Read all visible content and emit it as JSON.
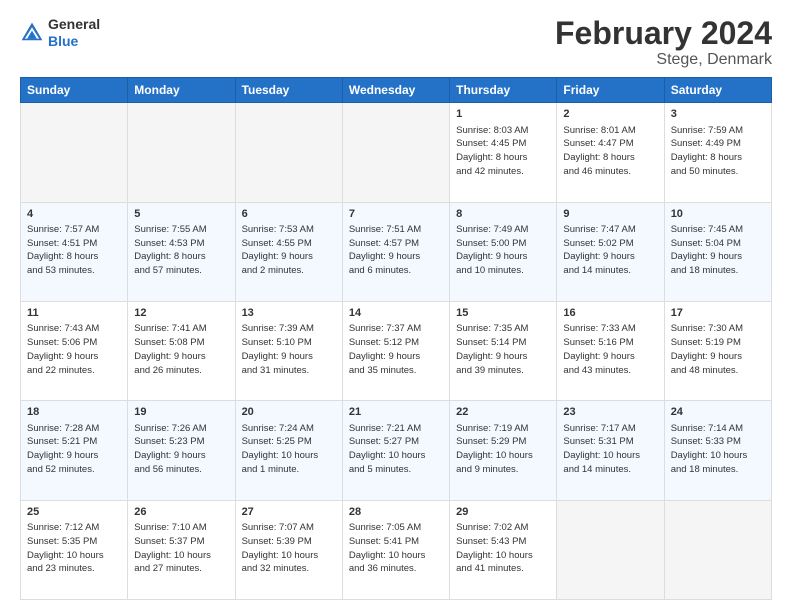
{
  "header": {
    "logo_line1": "General",
    "logo_line2": "Blue",
    "title": "February 2024",
    "subtitle": "Stege, Denmark"
  },
  "days": [
    "Sunday",
    "Monday",
    "Tuesday",
    "Wednesday",
    "Thursday",
    "Friday",
    "Saturday"
  ],
  "weeks": [
    [
      {
        "num": "",
        "info": ""
      },
      {
        "num": "",
        "info": ""
      },
      {
        "num": "",
        "info": ""
      },
      {
        "num": "",
        "info": ""
      },
      {
        "num": "1",
        "info": "Sunrise: 8:03 AM\nSunset: 4:45 PM\nDaylight: 8 hours\nand 42 minutes."
      },
      {
        "num": "2",
        "info": "Sunrise: 8:01 AM\nSunset: 4:47 PM\nDaylight: 8 hours\nand 46 minutes."
      },
      {
        "num": "3",
        "info": "Sunrise: 7:59 AM\nSunset: 4:49 PM\nDaylight: 8 hours\nand 50 minutes."
      }
    ],
    [
      {
        "num": "4",
        "info": "Sunrise: 7:57 AM\nSunset: 4:51 PM\nDaylight: 8 hours\nand 53 minutes."
      },
      {
        "num": "5",
        "info": "Sunrise: 7:55 AM\nSunset: 4:53 PM\nDaylight: 8 hours\nand 57 minutes."
      },
      {
        "num": "6",
        "info": "Sunrise: 7:53 AM\nSunset: 4:55 PM\nDaylight: 9 hours\nand 2 minutes."
      },
      {
        "num": "7",
        "info": "Sunrise: 7:51 AM\nSunset: 4:57 PM\nDaylight: 9 hours\nand 6 minutes."
      },
      {
        "num": "8",
        "info": "Sunrise: 7:49 AM\nSunset: 5:00 PM\nDaylight: 9 hours\nand 10 minutes."
      },
      {
        "num": "9",
        "info": "Sunrise: 7:47 AM\nSunset: 5:02 PM\nDaylight: 9 hours\nand 14 minutes."
      },
      {
        "num": "10",
        "info": "Sunrise: 7:45 AM\nSunset: 5:04 PM\nDaylight: 9 hours\nand 18 minutes."
      }
    ],
    [
      {
        "num": "11",
        "info": "Sunrise: 7:43 AM\nSunset: 5:06 PM\nDaylight: 9 hours\nand 22 minutes."
      },
      {
        "num": "12",
        "info": "Sunrise: 7:41 AM\nSunset: 5:08 PM\nDaylight: 9 hours\nand 26 minutes."
      },
      {
        "num": "13",
        "info": "Sunrise: 7:39 AM\nSunset: 5:10 PM\nDaylight: 9 hours\nand 31 minutes."
      },
      {
        "num": "14",
        "info": "Sunrise: 7:37 AM\nSunset: 5:12 PM\nDaylight: 9 hours\nand 35 minutes."
      },
      {
        "num": "15",
        "info": "Sunrise: 7:35 AM\nSunset: 5:14 PM\nDaylight: 9 hours\nand 39 minutes."
      },
      {
        "num": "16",
        "info": "Sunrise: 7:33 AM\nSunset: 5:16 PM\nDaylight: 9 hours\nand 43 minutes."
      },
      {
        "num": "17",
        "info": "Sunrise: 7:30 AM\nSunset: 5:19 PM\nDaylight: 9 hours\nand 48 minutes."
      }
    ],
    [
      {
        "num": "18",
        "info": "Sunrise: 7:28 AM\nSunset: 5:21 PM\nDaylight: 9 hours\nand 52 minutes."
      },
      {
        "num": "19",
        "info": "Sunrise: 7:26 AM\nSunset: 5:23 PM\nDaylight: 9 hours\nand 56 minutes."
      },
      {
        "num": "20",
        "info": "Sunrise: 7:24 AM\nSunset: 5:25 PM\nDaylight: 10 hours\nand 1 minute."
      },
      {
        "num": "21",
        "info": "Sunrise: 7:21 AM\nSunset: 5:27 PM\nDaylight: 10 hours\nand 5 minutes."
      },
      {
        "num": "22",
        "info": "Sunrise: 7:19 AM\nSunset: 5:29 PM\nDaylight: 10 hours\nand 9 minutes."
      },
      {
        "num": "23",
        "info": "Sunrise: 7:17 AM\nSunset: 5:31 PM\nDaylight: 10 hours\nand 14 minutes."
      },
      {
        "num": "24",
        "info": "Sunrise: 7:14 AM\nSunset: 5:33 PM\nDaylight: 10 hours\nand 18 minutes."
      }
    ],
    [
      {
        "num": "25",
        "info": "Sunrise: 7:12 AM\nSunset: 5:35 PM\nDaylight: 10 hours\nand 23 minutes."
      },
      {
        "num": "26",
        "info": "Sunrise: 7:10 AM\nSunset: 5:37 PM\nDaylight: 10 hours\nand 27 minutes."
      },
      {
        "num": "27",
        "info": "Sunrise: 7:07 AM\nSunset: 5:39 PM\nDaylight: 10 hours\nand 32 minutes."
      },
      {
        "num": "28",
        "info": "Sunrise: 7:05 AM\nSunset: 5:41 PM\nDaylight: 10 hours\nand 36 minutes."
      },
      {
        "num": "29",
        "info": "Sunrise: 7:02 AM\nSunset: 5:43 PM\nDaylight: 10 hours\nand 41 minutes."
      },
      {
        "num": "",
        "info": ""
      },
      {
        "num": "",
        "info": ""
      }
    ]
  ]
}
